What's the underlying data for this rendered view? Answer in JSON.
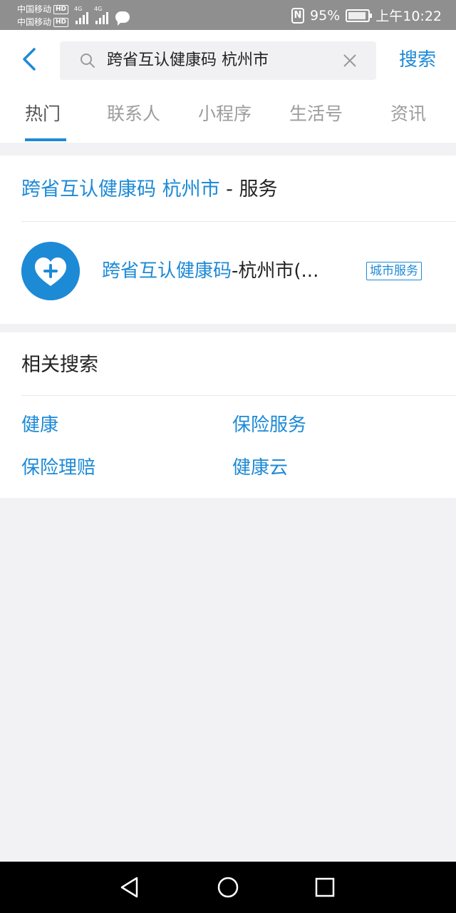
{
  "status_bar": {
    "carrier_1": "中国移动",
    "carrier_2": "中国移动",
    "hd_badge": "HD",
    "network_tag_1": "4G",
    "network_tag_2": "4G",
    "nfc_label": "N",
    "battery_percent": "95%",
    "time": "上午10:22"
  },
  "search": {
    "query": "跨省互认健康码 杭州市",
    "submit_label": "搜索"
  },
  "tabs": [
    {
      "label": "热门",
      "active": true
    },
    {
      "label": "联系人",
      "active": false
    },
    {
      "label": "小程序",
      "active": false
    },
    {
      "label": "生活号",
      "active": false
    },
    {
      "label": "资讯",
      "active": false
    }
  ],
  "service_section": {
    "title_highlight": "跨省互认健康码 杭州市",
    "title_suffix": " - 服务",
    "item": {
      "name_highlight": "跨省互认健康码",
      "name_rest": "-杭州市(...",
      "tag": "城市服务",
      "icon": "heart-plus-icon"
    }
  },
  "related_searches": {
    "title": "相关搜索",
    "items": [
      "健康",
      "保险服务",
      "保险理赔",
      "健康云"
    ]
  },
  "colors": {
    "accent": "#1d8ad6",
    "status_bar_bg": "#8f8f8f",
    "page_bg": "#f2f2f4",
    "nav_bg": "#000000"
  }
}
